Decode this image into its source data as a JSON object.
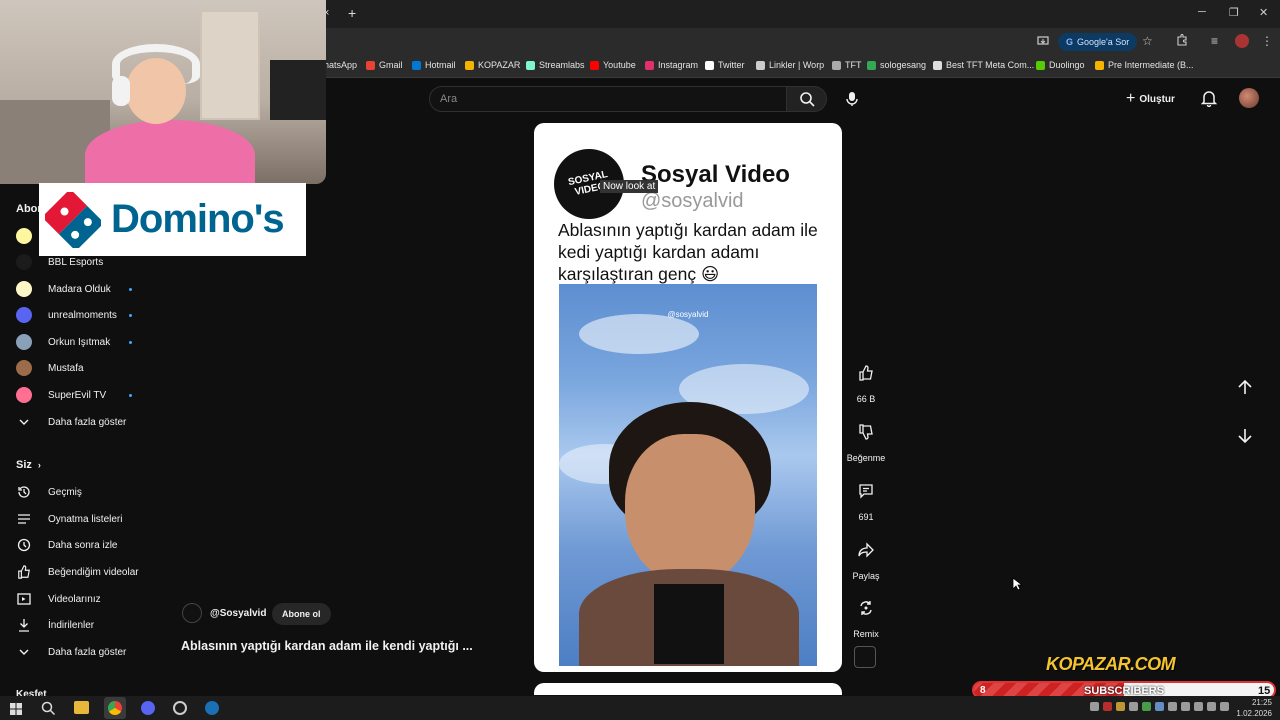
{
  "browser": {
    "new_tab": "+",
    "close_tab": "×",
    "window": {
      "minimize": "─",
      "restore": "❐",
      "close": "✕"
    },
    "google_pill": "Google'a Sor",
    "bookmarks": [
      {
        "label": "hatsApp",
        "color": "#25d366"
      },
      {
        "label": "Gmail",
        "color": "#ea4335"
      },
      {
        "label": "Hotmail",
        "color": "#0078d4"
      },
      {
        "label": "KOPAZAR",
        "color": "#f4b400"
      },
      {
        "label": "Streamlabs",
        "color": "#80f5d2"
      },
      {
        "label": "Youtube",
        "color": "#ff0000"
      },
      {
        "label": "Instagram",
        "color": "#e1306c"
      },
      {
        "label": "Twitter",
        "color": "#ffffff"
      },
      {
        "label": "Linkler | Worp",
        "color": "#cccccc"
      },
      {
        "label": "TFT",
        "color": "#aaaaaa"
      },
      {
        "label": "sologesang",
        "color": "#34a853"
      },
      {
        "label": "Best TFT Meta Com...",
        "color": "#dddddd"
      },
      {
        "label": "Duolingo",
        "color": "#58cc02"
      },
      {
        "label": "Pre Intermediate (B...",
        "color": "#f4b400"
      }
    ]
  },
  "header": {
    "search_placeholder": "Ara",
    "create_label": "Oluştur"
  },
  "webcam": {
    "sponsor": "Domino's"
  },
  "sidebar": {
    "subs_heading": "Abon",
    "channels": [
      {
        "name": "BBL Esports",
        "color": "#1b1b1b",
        "dot": false
      },
      {
        "name": "Madara Olduk",
        "color": "#fff6c7",
        "dot": true
      },
      {
        "name": "unrealmoments",
        "color": "#5865f2",
        "dot": true
      },
      {
        "name": "Orkun Işıtmak",
        "color": "#8aa0b8",
        "dot": true
      },
      {
        "name": "Mustafa",
        "color": "#9b6b4a",
        "dot": false
      },
      {
        "name": "SuperEvil TV",
        "color": "#ff6f91",
        "dot": true
      }
    ],
    "show_more": "Daha fazla göster",
    "you_heading": "Siz",
    "you_items": [
      {
        "label": "Geçmiş",
        "icon": "history-icon"
      },
      {
        "label": "Oynatma listeleri",
        "icon": "playlist-icon"
      },
      {
        "label": "Daha sonra izle",
        "icon": "clock-icon"
      },
      {
        "label": "Beğendiğim videolar",
        "icon": "thumbs-up-icon"
      },
      {
        "label": "Videolarınız",
        "icon": "video-icon"
      },
      {
        "label": "İndirilenler",
        "icon": "download-icon"
      }
    ],
    "show_more_2": "Daha fazla göster",
    "explore_heading": "Keşfet"
  },
  "short": {
    "brand_title": "Sosyal Video",
    "brand_handle": "@sosyalvid",
    "logo_text": "SOSYAL VIDEO",
    "now_look": "Now look at",
    "caption": "Ablasının yaptığı kardan adam ile kedi yaptığı kardan adamı karşılaştıran genç 😃",
    "watermark": "@sosyalvid",
    "channel_handle": "@Sosyalvid",
    "subscribe_label": "Abone ol",
    "title": "Ablasının yaptığı kardan adam ile kendi yaptığı ..."
  },
  "actions": {
    "like_count": "66 B",
    "dislike_label": "Beğenme",
    "comment_count": "691",
    "share_label": "Paylaş",
    "remix_label": "Remix"
  },
  "overlay": {
    "kopazar": "KOPAZAR.COM",
    "sub_left": "8",
    "sub_label": "SUBSCRIBERS",
    "sub_right": "15"
  },
  "taskbar": {
    "time": "21:25",
    "date": "1.02.2026"
  }
}
